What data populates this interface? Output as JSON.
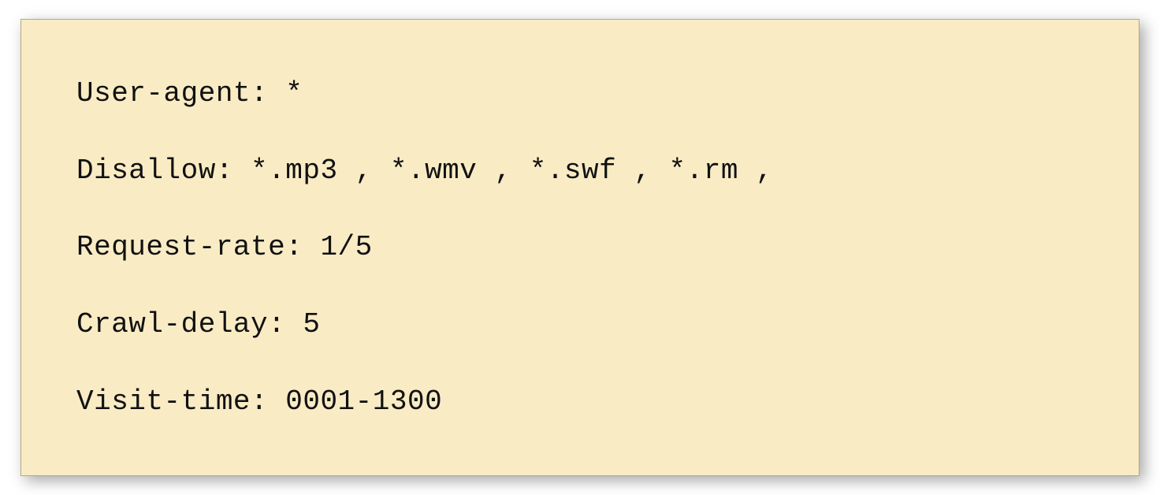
{
  "lines": [
    "User-agent: *",
    "Disallow: *.mp3 , *.wmv , *.swf , *.rm ,",
    "Request-rate: 1/5",
    "Crawl-delay: 5",
    "Visit-time: 0001-1300"
  ]
}
